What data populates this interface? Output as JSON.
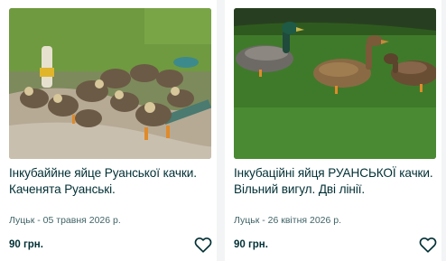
{
  "listings": [
    {
      "title": "Інкубаййне яйце Руанської качки. Каченята Руанські.",
      "location_date": "Луцьк - 05 травня 2026 р.",
      "price": "90 грн.",
      "image": "ducklings-on-grass-photo",
      "favorite_icon": "heart-outline-icon"
    },
    {
      "title": "Інкубаційні яйця РУАНСЬКОЇ качки. Вільний вигул. Дві лінії.",
      "location_date": "Луцьк - 26 квітня 2026 р.",
      "price": "90 грн.",
      "image": "adult-ducks-on-lawn-photo",
      "favorite_icon": "heart-outline-icon"
    }
  ],
  "colors": {
    "text": "#002f34",
    "meta_text": "#406367",
    "card_bg": "#ffffff",
    "page_bg": "#f2f4f5"
  }
}
